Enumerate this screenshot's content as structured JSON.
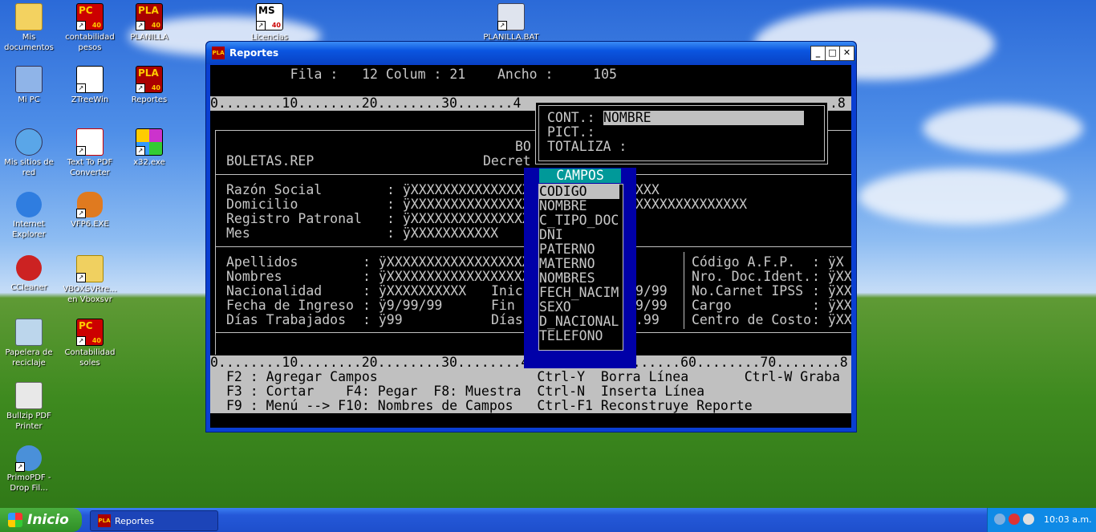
{
  "desktop": {
    "icons": [
      {
        "label": "Mis documentos"
      },
      {
        "label": "contabilidad pesos"
      },
      {
        "label": "PLANILLA"
      },
      {
        "label": "Licencias"
      },
      {
        "label": "PLANILLA.BAT"
      },
      {
        "label": "Mi PC"
      },
      {
        "label": "ZTreeWin"
      },
      {
        "label": "Reportes"
      },
      {
        "label": "Mis sitios de red"
      },
      {
        "label": "Text To PDF Converter"
      },
      {
        "label": "x32.exe"
      },
      {
        "label": "Internet Explorer"
      },
      {
        "label": "VFP6.EXE"
      },
      {
        "label": "CCleaner"
      },
      {
        "label": "VBOXSVRre... en Vboxsvr"
      },
      {
        "label": "Papelera de reciclaje"
      },
      {
        "label": "Contabilidad soles"
      },
      {
        "label": "Bullzip PDF Printer"
      },
      {
        "label": "PrimoPDF - Drop Fil..."
      }
    ],
    "icon_glyphs": {
      "pc": "PC",
      "pla": "PLA",
      "num": "40",
      "ms": "MS"
    }
  },
  "window": {
    "title": "Reportes",
    "icon_text": "PLA",
    "buttons": {
      "minimize": "_",
      "maximize": "□",
      "close": "✕"
    }
  },
  "console": {
    "header_line": "     Fila :   12 Colum : 21    Ancho :     105",
    "ruler_top": "0........10........20........30.......4",
    "ruler_top_end": ".8",
    "ruler_bottom": "0........10........20........30........40........50........60........70........8",
    "title_line": "BOLETAS.REP",
    "bo_text": "BO",
    "decret_text": "Decret",
    "company_fields": [
      {
        "label": "Razón Social",
        "value": ": ÿXXXXXXXXXXXXXXX"
      },
      {
        "label": "Domicilio",
        "value": ": ÿXXXXXXXXXXXXXXX"
      },
      {
        "label": "Registro Patronal",
        "value": ": ÿXXXXXXXXXXXXXXX"
      },
      {
        "label": "Mes",
        "value": ": ÿXXXXXXXXXXX"
      }
    ],
    "company_right": [
      "XXX",
      "XXXXXXXXXXXXXX"
    ],
    "employee_left": [
      {
        "label": "Apellidos",
        "value": ": ÿXXXXXXXXXXXXXXXXXX"
      },
      {
        "label": "Nombres",
        "value": ": ÿXXXXXXXXXXXXXXXXXX"
      },
      {
        "label": "Nacionalidad",
        "value": ": ÿXXXXXXXXXX"
      },
      {
        "label": "Fecha de Ingreso",
        "value": ": ÿ9/99/99"
      },
      {
        "label": "Días Trabajados",
        "value": ": ÿ99"
      }
    ],
    "employee_mid": [
      "Inic",
      "Fin",
      "Días"
    ],
    "employee_mid_values": [
      "9/99",
      "9/99",
      ".99"
    ],
    "employee_right": [
      {
        "label": "Código A.F.P.",
        "value": ": ÿX"
      },
      {
        "label": "Nro. Doc.Ident.",
        "value": ": ÿXX"
      },
      {
        "label": "No.Carnet IPSS",
        "value": ": ÿXX"
      },
      {
        "label": "Cargo",
        "value": ": ÿXX"
      },
      {
        "label": "Centro de Costo",
        "value": ": ÿXX"
      }
    ],
    "status_lines": [
      "F2 : Agregar Campos                    Ctrl-Y  Borra Línea       Ctrl-W Graba",
      "F3 : Cortar    F4: Pegar  F8: Muestra  Ctrl-N  Inserta Línea",
      "F9 : Menú --> F10: Nombres de Campos   Ctrl-F1 Reconstruye Reporte"
    ]
  },
  "cont_popup": {
    "cont_label": "CONT.:",
    "cont_value": "NOMBRE",
    "pict_label": "PICT.:",
    "totaliza_label": "TOTALIZA :"
  },
  "campos_list": {
    "header": "CAMPOS",
    "items": [
      "CODIGO",
      "NOMBRE",
      "C_TIPO_DOC",
      "DNI",
      "PATERNO",
      "MATERNO",
      "NOMBRES",
      "FECH_NACIM",
      "SEXO",
      "D_NACIONAL",
      "TELEFONO"
    ],
    "selected_index": 0
  },
  "taskbar": {
    "start_label": "Inicio",
    "task_label": "Reportes",
    "task_icon_text": "PLA",
    "clock": "10:03 a.m."
  }
}
